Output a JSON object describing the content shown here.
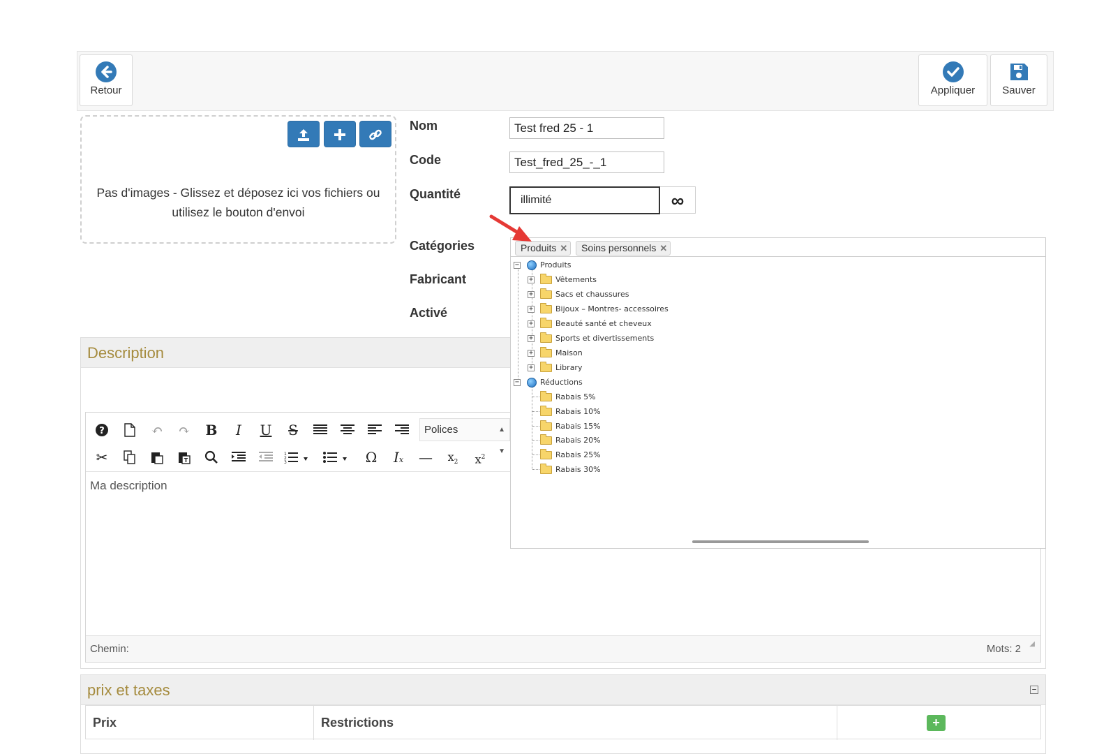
{
  "toolbar": {
    "back_label": "Retour",
    "apply_label": "Appliquer",
    "save_label": "Sauver"
  },
  "dropzone": {
    "message": "Pas d'images - Glissez et déposez ici vos fichiers ou utilisez le bouton d'envoi"
  },
  "form": {
    "nom_label": "Nom",
    "nom_value": "Test fred 25 - 1",
    "code_label": "Code",
    "code_value": "Test_fred_25_-_1",
    "quantite_label": "Quantité",
    "quantite_value": "illimité",
    "infinity_symbol": "∞",
    "categories_label": "Catégories",
    "fabricant_label": "Fabricant",
    "active_label": "Activé"
  },
  "categories": {
    "tags": [
      "Produits",
      "Soins personnels"
    ],
    "tree": [
      {
        "label": "Produits",
        "type": "root",
        "expanded": true,
        "children": [
          "Vêtements",
          "Sacs et chaussures",
          "Bijoux – Montres- accessoires",
          "Beauté santé et cheveux",
          "Sports et divertissements",
          "Maison",
          "Library"
        ]
      },
      {
        "label": "Réductions",
        "type": "root",
        "expanded": true,
        "children": [
          "Rabais 5%",
          "Rabais 10%",
          "Rabais 15%",
          "Rabais 20%",
          "Rabais 25%",
          "Rabais 30%"
        ]
      }
    ]
  },
  "description": {
    "title": "Description",
    "fonts_select": "Polices",
    "content": "Ma description",
    "path_label": "Chemin:",
    "words_label": "Mots: 2"
  },
  "prix": {
    "title": "prix et taxes",
    "col_prix": "Prix",
    "col_restrictions": "Restrictions",
    "add_symbol": "+"
  },
  "colors": {
    "primary": "#337ab7",
    "panel_title": "#a58b3e",
    "success": "#5cb85c",
    "arrow": "#e53935"
  }
}
